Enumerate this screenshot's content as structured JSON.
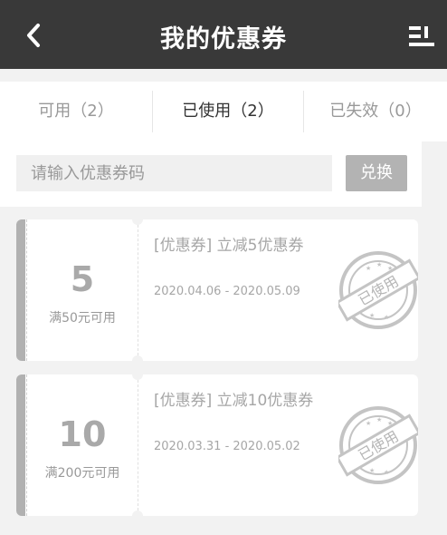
{
  "header": {
    "title": "我的优惠券",
    "back_icon": "chevron-left-icon",
    "menu_icon": "list-menu-icon"
  },
  "tabs": [
    {
      "label": "可用（2）",
      "active": false
    },
    {
      "label": "已使用（2）",
      "active": true
    },
    {
      "label": "已失效（0）",
      "active": false
    }
  ],
  "redeem": {
    "placeholder": "请输入优惠券码",
    "button_label": "兑换"
  },
  "coupons": [
    {
      "amount": "5",
      "condition": "满50元可用",
      "name": "[优惠券] 立减5优惠券",
      "dates": "2020.04.06 - 2020.05.09",
      "stamp": "已使用"
    },
    {
      "amount": "10",
      "condition": "满200元可用",
      "name": "[优惠券] 立减10优惠券",
      "dates": "2020.03.31 - 2020.05.02",
      "stamp": "已使用"
    }
  ],
  "colors": {
    "header_bg": "#393939",
    "page_bg": "#f2f2f2",
    "used_gray": "#b1b1b1"
  }
}
